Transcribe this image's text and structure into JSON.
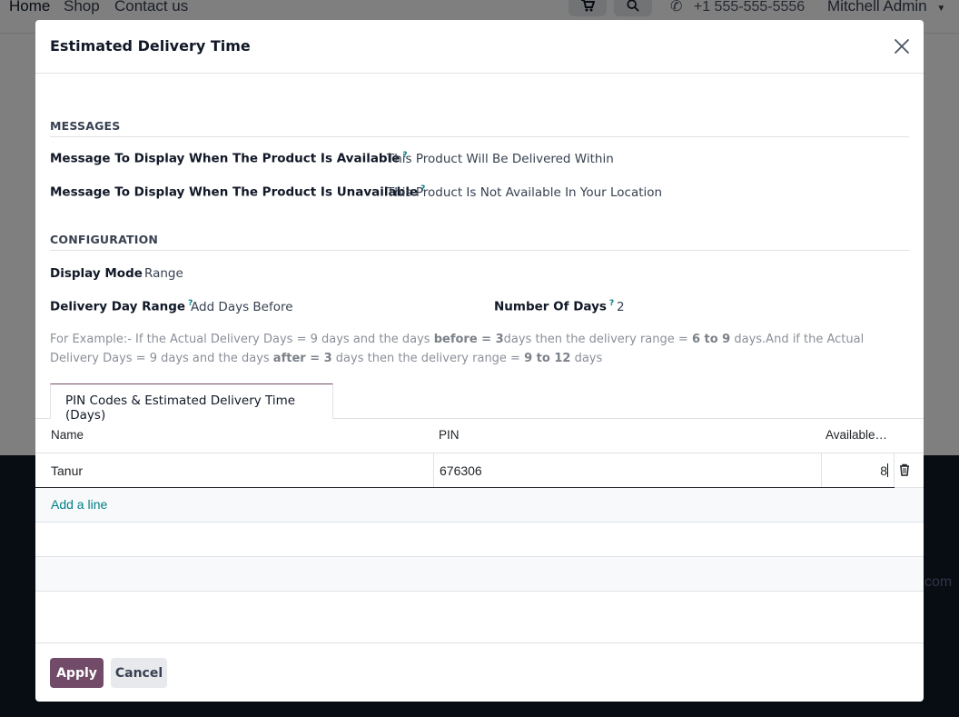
{
  "navbar": {
    "home": "Home",
    "shop": "Shop",
    "contact": "Contact us",
    "phone": "+1 555-555-5556",
    "user": "Mitchell Admin"
  },
  "footer": {
    "partial_text": "com"
  },
  "modal": {
    "title": "Estimated Delivery Time",
    "messages_section": "MESSAGES",
    "available_label": "Message To Display When The Product Is Available",
    "available_value": "This Product Will Be Delivered Within",
    "unavailable_label": "Message To Display When The Product Is Unavailable",
    "unavailable_value": "This Product Is Not Available In Your Location",
    "configuration_section": "CONFIGURATION",
    "display_mode_label": "Display Mode",
    "display_mode_value": "Range",
    "delivery_day_range_label": "Delivery Day Range",
    "delivery_day_range_value": "Add Days Before",
    "number_of_days_label": "Number Of Days",
    "number_of_days_value": "2",
    "help_mark": "?",
    "example": {
      "p1": "For Example:- If the Actual Delivery Days = 9 days and the days ",
      "b1": "before = 3",
      "p2": "days then the delivery range = ",
      "b2": "6 to 9",
      "p3": " days.And if the Actual Delivery Days = 9 days and the days ",
      "b3": "after = 3",
      "p4": " days then the delivery range = ",
      "b4": "9 to 12",
      "p5": " days"
    },
    "tab_label": "PIN Codes & Estimated Delivery Time (Days)",
    "table": {
      "columns": [
        "Name",
        "PIN",
        "Available…"
      ],
      "rows": [
        {
          "name": "Tanur",
          "pin": "676306",
          "available": "8"
        }
      ],
      "add_line": "Add a line"
    },
    "apply_label": "Apply",
    "cancel_label": "Cancel"
  },
  "colors": {
    "primary": "#714B67",
    "link": "#017e84",
    "footer_bg": "#111827"
  }
}
